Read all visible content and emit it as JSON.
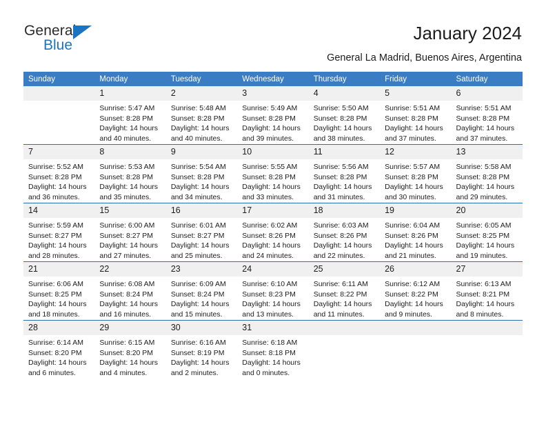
{
  "logo": {
    "primary_text": "General",
    "secondary_text": "Blue",
    "triangle_icon": "triangle-icon",
    "primary_color": "#2b2b2b",
    "accent_color": "#1a74c0"
  },
  "header": {
    "title": "January 2024",
    "subtitle": "General La Madrid, Buenos Aires, Argentina"
  },
  "calendar": {
    "header_bg": "#3b7dc4",
    "header_text_color": "#ffffff",
    "daynum_bg": "#f0f0f0",
    "row_border_color": "#2e6cb0",
    "weekdays": [
      "Sunday",
      "Monday",
      "Tuesday",
      "Wednesday",
      "Thursday",
      "Friday",
      "Saturday"
    ],
    "weeks": [
      [
        {
          "day": "",
          "sunrise": "",
          "sunset": "",
          "daylight_1": "",
          "daylight_2": "",
          "blank": true
        },
        {
          "day": "1",
          "sunrise": "Sunrise: 5:47 AM",
          "sunset": "Sunset: 8:28 PM",
          "daylight_1": "Daylight: 14 hours",
          "daylight_2": "and 40 minutes."
        },
        {
          "day": "2",
          "sunrise": "Sunrise: 5:48 AM",
          "sunset": "Sunset: 8:28 PM",
          "daylight_1": "Daylight: 14 hours",
          "daylight_2": "and 40 minutes."
        },
        {
          "day": "3",
          "sunrise": "Sunrise: 5:49 AM",
          "sunset": "Sunset: 8:28 PM",
          "daylight_1": "Daylight: 14 hours",
          "daylight_2": "and 39 minutes."
        },
        {
          "day": "4",
          "sunrise": "Sunrise: 5:50 AM",
          "sunset": "Sunset: 8:28 PM",
          "daylight_1": "Daylight: 14 hours",
          "daylight_2": "and 38 minutes."
        },
        {
          "day": "5",
          "sunrise": "Sunrise: 5:51 AM",
          "sunset": "Sunset: 8:28 PM",
          "daylight_1": "Daylight: 14 hours",
          "daylight_2": "and 37 minutes."
        },
        {
          "day": "6",
          "sunrise": "Sunrise: 5:51 AM",
          "sunset": "Sunset: 8:28 PM",
          "daylight_1": "Daylight: 14 hours",
          "daylight_2": "and 37 minutes."
        }
      ],
      [
        {
          "day": "7",
          "sunrise": "Sunrise: 5:52 AM",
          "sunset": "Sunset: 8:28 PM",
          "daylight_1": "Daylight: 14 hours",
          "daylight_2": "and 36 minutes."
        },
        {
          "day": "8",
          "sunrise": "Sunrise: 5:53 AM",
          "sunset": "Sunset: 8:28 PM",
          "daylight_1": "Daylight: 14 hours",
          "daylight_2": "and 35 minutes."
        },
        {
          "day": "9",
          "sunrise": "Sunrise: 5:54 AM",
          "sunset": "Sunset: 8:28 PM",
          "daylight_1": "Daylight: 14 hours",
          "daylight_2": "and 34 minutes."
        },
        {
          "day": "10",
          "sunrise": "Sunrise: 5:55 AM",
          "sunset": "Sunset: 8:28 PM",
          "daylight_1": "Daylight: 14 hours",
          "daylight_2": "and 33 minutes."
        },
        {
          "day": "11",
          "sunrise": "Sunrise: 5:56 AM",
          "sunset": "Sunset: 8:28 PM",
          "daylight_1": "Daylight: 14 hours",
          "daylight_2": "and 31 minutes."
        },
        {
          "day": "12",
          "sunrise": "Sunrise: 5:57 AM",
          "sunset": "Sunset: 8:28 PM",
          "daylight_1": "Daylight: 14 hours",
          "daylight_2": "and 30 minutes."
        },
        {
          "day": "13",
          "sunrise": "Sunrise: 5:58 AM",
          "sunset": "Sunset: 8:28 PM",
          "daylight_1": "Daylight: 14 hours",
          "daylight_2": "and 29 minutes."
        }
      ],
      [
        {
          "day": "14",
          "sunrise": "Sunrise: 5:59 AM",
          "sunset": "Sunset: 8:27 PM",
          "daylight_1": "Daylight: 14 hours",
          "daylight_2": "and 28 minutes."
        },
        {
          "day": "15",
          "sunrise": "Sunrise: 6:00 AM",
          "sunset": "Sunset: 8:27 PM",
          "daylight_1": "Daylight: 14 hours",
          "daylight_2": "and 27 minutes."
        },
        {
          "day": "16",
          "sunrise": "Sunrise: 6:01 AM",
          "sunset": "Sunset: 8:27 PM",
          "daylight_1": "Daylight: 14 hours",
          "daylight_2": "and 25 minutes."
        },
        {
          "day": "17",
          "sunrise": "Sunrise: 6:02 AM",
          "sunset": "Sunset: 8:26 PM",
          "daylight_1": "Daylight: 14 hours",
          "daylight_2": "and 24 minutes."
        },
        {
          "day": "18",
          "sunrise": "Sunrise: 6:03 AM",
          "sunset": "Sunset: 8:26 PM",
          "daylight_1": "Daylight: 14 hours",
          "daylight_2": "and 22 minutes."
        },
        {
          "day": "19",
          "sunrise": "Sunrise: 6:04 AM",
          "sunset": "Sunset: 8:26 PM",
          "daylight_1": "Daylight: 14 hours",
          "daylight_2": "and 21 minutes."
        },
        {
          "day": "20",
          "sunrise": "Sunrise: 6:05 AM",
          "sunset": "Sunset: 8:25 PM",
          "daylight_1": "Daylight: 14 hours",
          "daylight_2": "and 19 minutes."
        }
      ],
      [
        {
          "day": "21",
          "sunrise": "Sunrise: 6:06 AM",
          "sunset": "Sunset: 8:25 PM",
          "daylight_1": "Daylight: 14 hours",
          "daylight_2": "and 18 minutes."
        },
        {
          "day": "22",
          "sunrise": "Sunrise: 6:08 AM",
          "sunset": "Sunset: 8:24 PM",
          "daylight_1": "Daylight: 14 hours",
          "daylight_2": "and 16 minutes."
        },
        {
          "day": "23",
          "sunrise": "Sunrise: 6:09 AM",
          "sunset": "Sunset: 8:24 PM",
          "daylight_1": "Daylight: 14 hours",
          "daylight_2": "and 15 minutes."
        },
        {
          "day": "24",
          "sunrise": "Sunrise: 6:10 AM",
          "sunset": "Sunset: 8:23 PM",
          "daylight_1": "Daylight: 14 hours",
          "daylight_2": "and 13 minutes."
        },
        {
          "day": "25",
          "sunrise": "Sunrise: 6:11 AM",
          "sunset": "Sunset: 8:22 PM",
          "daylight_1": "Daylight: 14 hours",
          "daylight_2": "and 11 minutes."
        },
        {
          "day": "26",
          "sunrise": "Sunrise: 6:12 AM",
          "sunset": "Sunset: 8:22 PM",
          "daylight_1": "Daylight: 14 hours",
          "daylight_2": "and 9 minutes."
        },
        {
          "day": "27",
          "sunrise": "Sunrise: 6:13 AM",
          "sunset": "Sunset: 8:21 PM",
          "daylight_1": "Daylight: 14 hours",
          "daylight_2": "and 8 minutes."
        }
      ],
      [
        {
          "day": "28",
          "sunrise": "Sunrise: 6:14 AM",
          "sunset": "Sunset: 8:20 PM",
          "daylight_1": "Daylight: 14 hours",
          "daylight_2": "and 6 minutes."
        },
        {
          "day": "29",
          "sunrise": "Sunrise: 6:15 AM",
          "sunset": "Sunset: 8:20 PM",
          "daylight_1": "Daylight: 14 hours",
          "daylight_2": "and 4 minutes."
        },
        {
          "day": "30",
          "sunrise": "Sunrise: 6:16 AM",
          "sunset": "Sunset: 8:19 PM",
          "daylight_1": "Daylight: 14 hours",
          "daylight_2": "and 2 minutes."
        },
        {
          "day": "31",
          "sunrise": "Sunrise: 6:18 AM",
          "sunset": "Sunset: 8:18 PM",
          "daylight_1": "Daylight: 14 hours",
          "daylight_2": "and 0 minutes."
        },
        {
          "day": "",
          "sunrise": "",
          "sunset": "",
          "daylight_1": "",
          "daylight_2": "",
          "blank": true
        },
        {
          "day": "",
          "sunrise": "",
          "sunset": "",
          "daylight_1": "",
          "daylight_2": "",
          "blank": true
        },
        {
          "day": "",
          "sunrise": "",
          "sunset": "",
          "daylight_1": "",
          "daylight_2": "",
          "blank": true
        }
      ]
    ]
  }
}
